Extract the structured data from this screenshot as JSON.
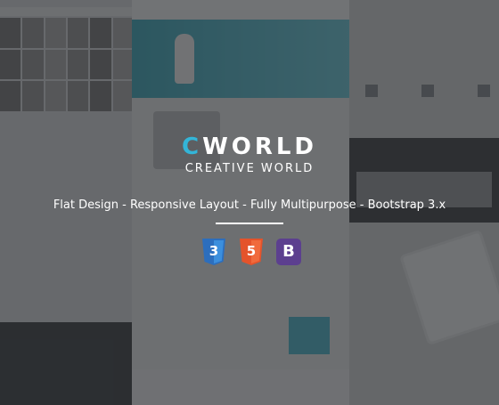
{
  "brand": {
    "accent_letter": "C",
    "rest": "WORLD",
    "tagline": "CREATIVE WORLD"
  },
  "features_line": "Flat Design - Responsive Layout - Fully Multipurpose - Bootstrap 3.x",
  "badges": [
    {
      "icon": "css3-icon",
      "label": "3",
      "color": "#2c6ebd"
    },
    {
      "icon": "html5-icon",
      "label": "5",
      "color": "#e4532b"
    },
    {
      "icon": "bootstrap-icon",
      "label": "B",
      "color": "#5c3f8f"
    }
  ],
  "colors": {
    "accent": "#33b5d8",
    "overlay": "#2d2f32",
    "text": "#ffffff"
  }
}
